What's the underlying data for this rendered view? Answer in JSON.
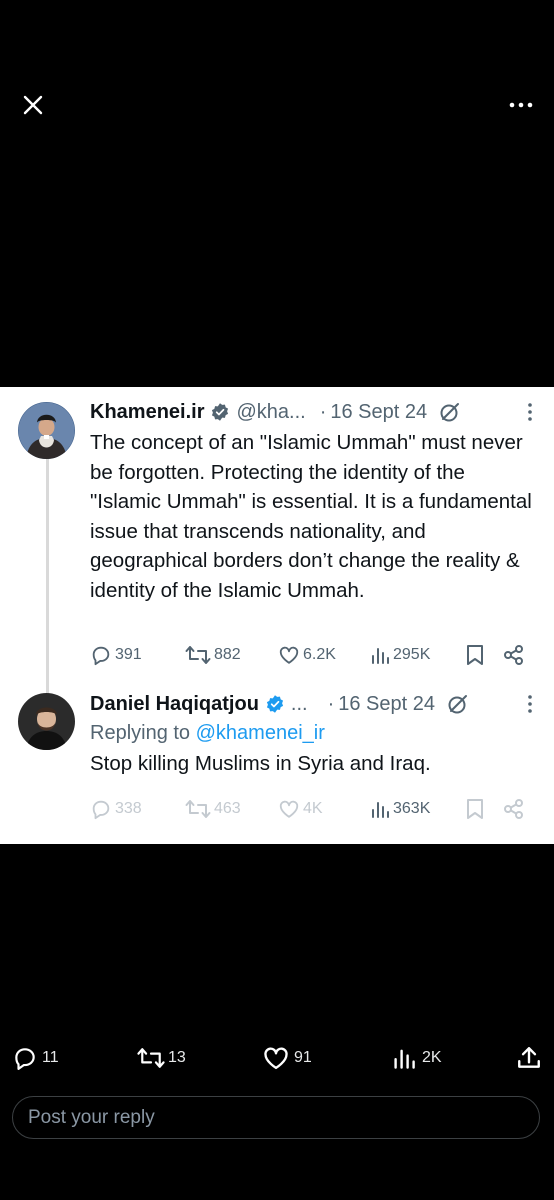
{
  "screenshot": {
    "tweet1": {
      "name": "Khamenei.ir",
      "handle": "@kha...",
      "separator": "·",
      "date": "16 Sept 24",
      "text": "The concept of an \"Islamic Ummah\" must never be forgotten. Protecting the identity of the \"Islamic Ummah\" is essential. It is a fundamental issue that transcends nationality, and geographical borders don’t change the reality & identity of the Islamic Ummah.",
      "replies": "391",
      "reposts": "882",
      "likes": "6.2K",
      "views": "295K"
    },
    "tweet2": {
      "name": "Daniel Haqiqatjou",
      "handle": "...",
      "separator": "·",
      "date": "16 Sept 24",
      "replying_prefix": "Replying to ",
      "replying_handle": "@khamenei_ir",
      "text": "Stop killing Muslims in Syria and Iraq.",
      "replies": "338",
      "reposts": "463",
      "likes": "4K",
      "views": "363K"
    }
  },
  "actions": {
    "replies": "11",
    "reposts": "13",
    "likes": "91",
    "views": "2K"
  },
  "reply_input": {
    "placeholder": "Post your reply"
  },
  "icons": {
    "close": "close-icon",
    "more": "more-horizontal-icon",
    "verified": "verified-badge-icon",
    "grok": "grok-icon",
    "reply": "reply-icon",
    "repost": "repost-icon",
    "like": "heart-icon",
    "views": "views-icon",
    "bookmark": "bookmark-icon",
    "share": "share-icon"
  },
  "colors": {
    "background": "#000000",
    "link": "#1d9bf0",
    "verified": "#1d9bf0",
    "muted": "#536471"
  }
}
